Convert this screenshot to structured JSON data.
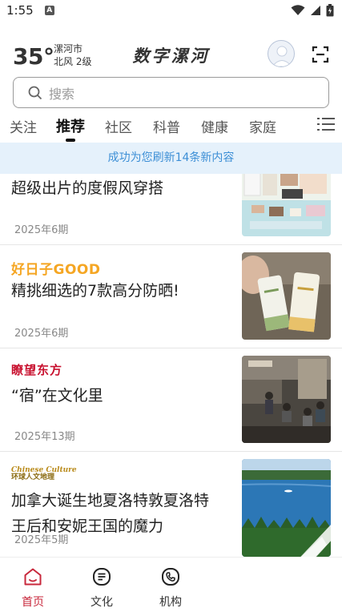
{
  "status_bar": {
    "time": "1:55",
    "notification_glyph": "A"
  },
  "header": {
    "temperature": "35°",
    "city": "漯河市",
    "wind": "北风  2级",
    "app_title": "数字漯河"
  },
  "search": {
    "placeholder": "搜索"
  },
  "tabs": [
    {
      "label": "关注"
    },
    {
      "label": "推荐",
      "active": true
    },
    {
      "label": "社区"
    },
    {
      "label": "科普"
    },
    {
      "label": "健康"
    },
    {
      "label": "家庭"
    }
  ],
  "refresh_banner": "成功为您刷新14条新内容",
  "articles": [
    {
      "source": "",
      "title": "超级出片的度假风穿搭",
      "issue": "2025年6期"
    },
    {
      "source": "好日子GOOD",
      "title": "精挑细选的7款高分防晒!",
      "issue": "2025年6期"
    },
    {
      "source": "瞭望东方",
      "title": "“宿”在文化里",
      "issue": "2025年13期"
    },
    {
      "source_line1": "Chinese Culture",
      "source_line2": "环球人文地理",
      "title": "加拿大诞生地夏洛特敦夏洛特王后和安妮王国的魔力",
      "issue": "2025年5期"
    }
  ],
  "bottom_nav": [
    {
      "label": "首页",
      "icon": "home-icon",
      "active": true
    },
    {
      "label": "文化",
      "icon": "document-icon"
    },
    {
      "label": "机构",
      "icon": "phone-icon"
    }
  ],
  "colors": {
    "accent": "#c8283c",
    "banner_bg": "#e5f1fb",
    "banner_text": "#3d8fd6",
    "haorizi_brand": "#f5a623",
    "liaowang_brand": "#c8102e"
  }
}
